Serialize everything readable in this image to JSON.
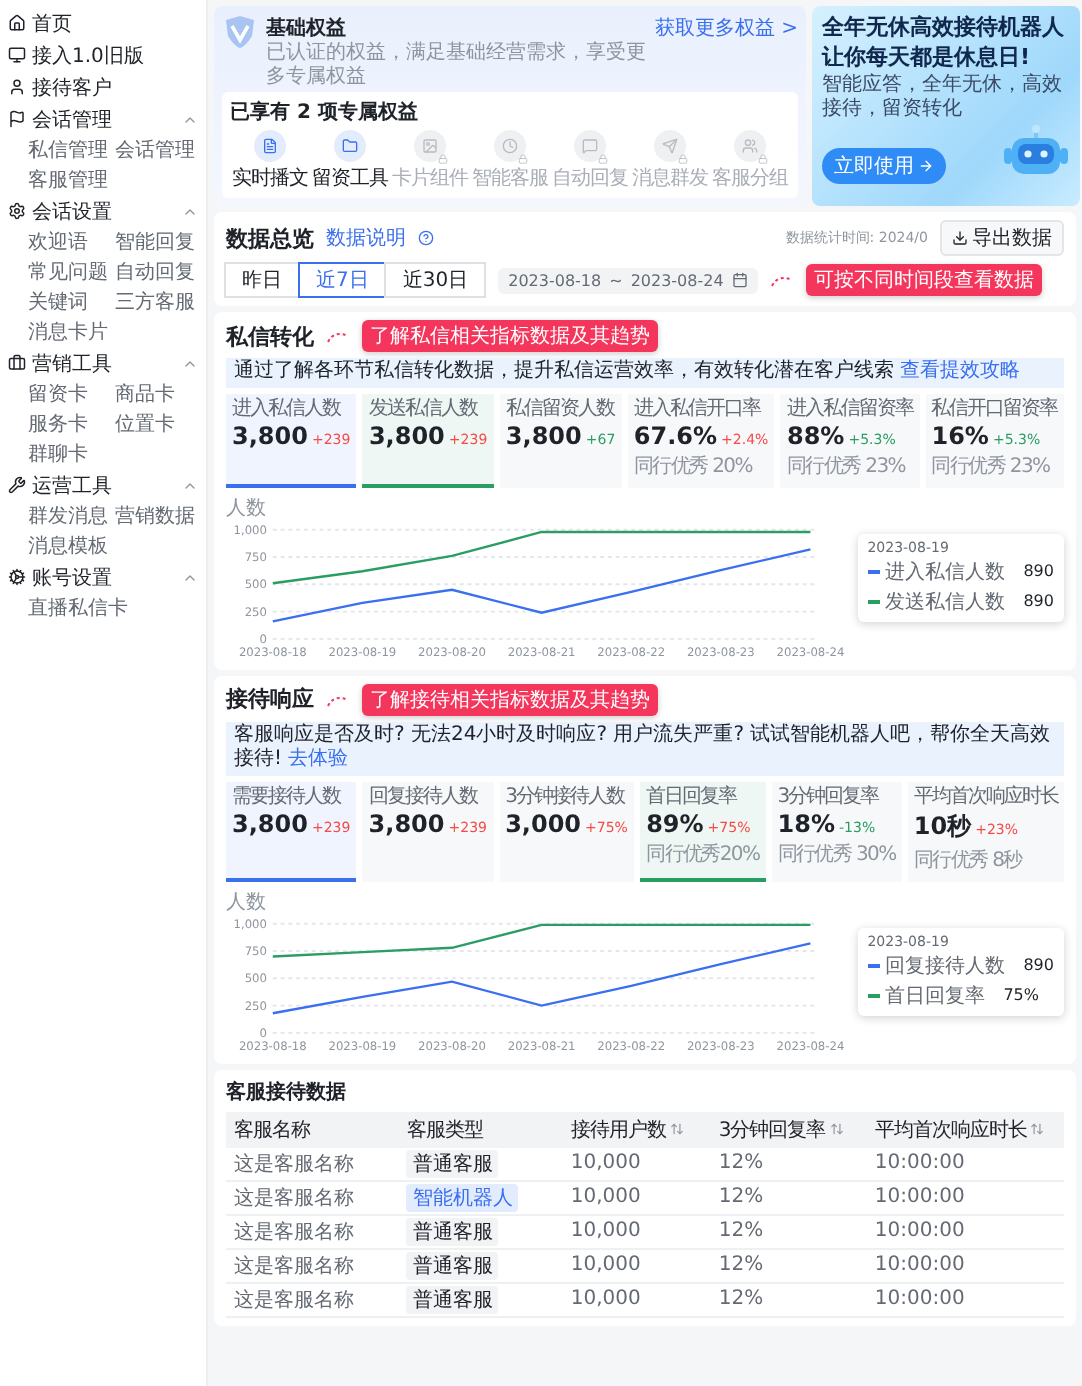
{
  "sidebar": {
    "items": [
      {
        "label": "首页"
      },
      {
        "label": "接入1.0旧版"
      },
      {
        "label": "接待客户"
      },
      {
        "label": "会话管理",
        "expanded": true,
        "children": [
          {
            "label": "私信管理"
          },
          {
            "label": "会话管理"
          },
          {
            "label": "客服管理"
          }
        ]
      },
      {
        "label": "会话设置",
        "expanded": true,
        "children": [
          {
            "label": "欢迎语"
          },
          {
            "label": "智能回复"
          },
          {
            "label": "常见问题"
          },
          {
            "label": "自动回复"
          },
          {
            "label": "关键词"
          },
          {
            "label": "三方客服"
          },
          {
            "label": "消息卡片"
          }
        ]
      },
      {
        "label": "营销工具",
        "expanded": true,
        "children": [
          {
            "label": "留资卡"
          },
          {
            "label": "商品卡"
          },
          {
            "label": "服务卡"
          },
          {
            "label": "位置卡"
          },
          {
            "label": "群聊卡"
          }
        ]
      },
      {
        "label": "运营工具",
        "expanded": true,
        "children": [
          {
            "label": "群发消息"
          },
          {
            "label": "营销数据"
          },
          {
            "label": "消息模板"
          }
        ]
      },
      {
        "label": "账号设置",
        "expanded": true,
        "children": [
          {
            "label": "直播私信卡"
          }
        ]
      }
    ]
  },
  "benefits": {
    "title": "基础权益",
    "description": "已认证的权益，满足基础经营需求，享受更多专属权益",
    "link": "获取更多权益 >",
    "owned": "已享有 2 项专属权益",
    "items": [
      {
        "label": "实时播文",
        "enabled": true
      },
      {
        "label": "留资工具",
        "enabled": true
      },
      {
        "label": "卡片组件",
        "enabled": false
      },
      {
        "label": "智能客服",
        "enabled": false
      },
      {
        "label": "自动回复",
        "enabled": false
      },
      {
        "label": "消息群发",
        "enabled": false
      },
      {
        "label": "客服分组",
        "enabled": false
      }
    ]
  },
  "ad": {
    "headline": "全年无休高效接待机器人",
    "subheadline": "让你每天都是休息日!",
    "text": "智能应答，全年无休，高效接待，留资转化",
    "button": "立即使用"
  },
  "overview": {
    "title": "数据总览",
    "help_link": "数据说明",
    "export_button": "导出数据",
    "updated": "数据统计时间: 2024/0",
    "tabs": [
      {
        "label": "昨日",
        "selected": false
      },
      {
        "label": "近7日",
        "selected": true
      },
      {
        "label": "近30日",
        "selected": false
      }
    ],
    "date_from": "2023-08-18",
    "date_separator": "~",
    "date_to": "2023-08-24",
    "callout": "可按不同时间段查看数据"
  },
  "sections": [
    {
      "title": "私信转化",
      "callout": "了解私信相关指标数据及其趋势",
      "info": "通过了解各环节私信转化数据，提升私信运营效率，有效转化潜在客户线索",
      "info_link": "查看提效攻略",
      "cards": [
        {
          "label": "进入私信人数",
          "value": "3,800",
          "delta": "+239",
          "rising": true,
          "selected": true,
          "color": "#3a6ff0"
        },
        {
          "label": "发送私信人数",
          "value": "3,800",
          "delta": "+239",
          "rising": true,
          "selected": true,
          "color": "#2a9d63"
        },
        {
          "label": "私信留资人数",
          "value": "3,800",
          "delta": "+67",
          "rising": false,
          "selected": false
        },
        {
          "label": "进入私信开口率",
          "value": "67.6%",
          "delta": "+2.4%",
          "rising": true,
          "benchmark": "同行优秀 20%",
          "selected": false
        },
        {
          "label": "进入私信留资率",
          "value": "88%",
          "delta": "+5.3%",
          "rising": false,
          "benchmark": "同行优秀 23%",
          "selected": false
        },
        {
          "label": "私信开口留资率",
          "value": "16%",
          "delta": "+5.3%",
          "rising": false,
          "benchmark": "同行优秀 23%",
          "selected": false
        }
      ],
      "chart_data": {
        "type": "line",
        "ylabel": "人数",
        "grid": true,
        "legend": "right",
        "categories": [
          "2023-08-18",
          "2023-08-19",
          "2023-08-20",
          "2023-08-21",
          "2023-08-22",
          "2023-08-23",
          "2023-08-24"
        ],
        "yticks": [
          0,
          250,
          500,
          750,
          {
            "value": 1000,
            "label": "1,000"
          }
        ],
        "ylim": [
          0,
          1000
        ],
        "series": [
          {
            "name": "进入私信人数",
            "color": "#3a6ff0",
            "values": [
              160,
              330,
              450,
              240,
              430,
              630,
              820
            ]
          },
          {
            "name": "发送私信人数",
            "color": "#2a9d63",
            "values": [
              510,
              620,
              760,
              980,
              980,
              980,
              980
            ]
          }
        ]
      },
      "tooltip": {
        "date": "2023-08-19",
        "values": [
          "890",
          "890"
        ]
      }
    },
    {
      "title": "接待响应",
      "callout": "了解接待相关指标数据及其趋势",
      "info": "客服响应是否及时? 无法24小时及时响应? 用户流失严重? 试试智能机器人吧，帮你全天高效接待!",
      "info_link": "去体验",
      "cards": [
        {
          "label": "需要接待人数",
          "value": "3,800",
          "delta": "+239",
          "rising": true,
          "selected": true,
          "color": "#3a6ff0"
        },
        {
          "label": "回复接待人数",
          "value": "3,800",
          "delta": "+239",
          "rising": true,
          "selected": false
        },
        {
          "label": "3分钟接待人数",
          "value": "3,000",
          "delta": "+75%",
          "rising": true,
          "selected": false
        },
        {
          "label": "首日回复率",
          "value": "89%",
          "delta": "+75%",
          "rising": true,
          "benchmark": "同行优秀20%",
          "selected": true,
          "color": "#2a9d63"
        },
        {
          "label": "3分钟回复率",
          "value": "18%",
          "delta": "-13%",
          "rising": false,
          "benchmark": "同行优秀 30%",
          "selected": false
        },
        {
          "label": "平均首次响应时长",
          "value": "10秒",
          "delta": "+23%",
          "rising": true,
          "benchmark": "同行优秀 8秒",
          "selected": false
        }
      ],
      "chart_data": {
        "type": "line",
        "ylabel": "人数",
        "grid": true,
        "legend": "right",
        "categories": [
          "2023-08-18",
          "2023-08-19",
          "2023-08-20",
          "2023-08-21",
          "2023-08-22",
          "2023-08-23",
          "2023-08-24"
        ],
        "yticks": [
          0,
          250,
          500,
          750,
          {
            "value": 1000,
            "label": "1,000"
          }
        ],
        "ylim": [
          0,
          1000
        ],
        "series": [
          {
            "name": "回复接待人数",
            "color": "#3a6ff0",
            "values": [
              180,
              330,
              470,
              250,
              430,
              630,
              820
            ]
          },
          {
            "name": "首日回复率",
            "color": "#2a9d63",
            "values": [
              700,
              740,
              780,
              990,
              990,
              990,
              990
            ]
          }
        ]
      },
      "tooltip": {
        "date": "2023-08-19",
        "values": [
          "890",
          "75%"
        ]
      }
    }
  ],
  "table": {
    "title": "客服接待数据",
    "columns": [
      {
        "label": "客服名称",
        "sortable": false
      },
      {
        "label": "客服类型",
        "sortable": false
      },
      {
        "label": "接待用户数",
        "sortable": true
      },
      {
        "label": "3分钟回复率",
        "sortable": true
      },
      {
        "label": "平均首次响应时长",
        "sortable": true
      }
    ],
    "rows": [
      {
        "name": "这是客服名称",
        "type": {
          "label": "普通客服",
          "kind": "normal"
        },
        "users": "10,000",
        "rate": "12%",
        "time": "10:00:00"
      },
      {
        "name": "这是客服名称",
        "type": {
          "label": "智能机器人",
          "kind": "robot"
        },
        "users": "10,000",
        "rate": "12%",
        "time": "10:00:00"
      },
      {
        "name": "这是客服名称",
        "type": {
          "label": "普通客服",
          "kind": "normal"
        },
        "users": "10,000",
        "rate": "12%",
        "time": "10:00:00"
      },
      {
        "name": "这是客服名称",
        "type": {
          "label": "普通客服",
          "kind": "normal"
        },
        "users": "10,000",
        "rate": "12%",
        "time": "10:00:00"
      },
      {
        "name": "这是客服名称",
        "type": {
          "label": "普通客服",
          "kind": "normal"
        },
        "users": "10,000",
        "rate": "12%",
        "time": "10:00:00"
      }
    ]
  }
}
